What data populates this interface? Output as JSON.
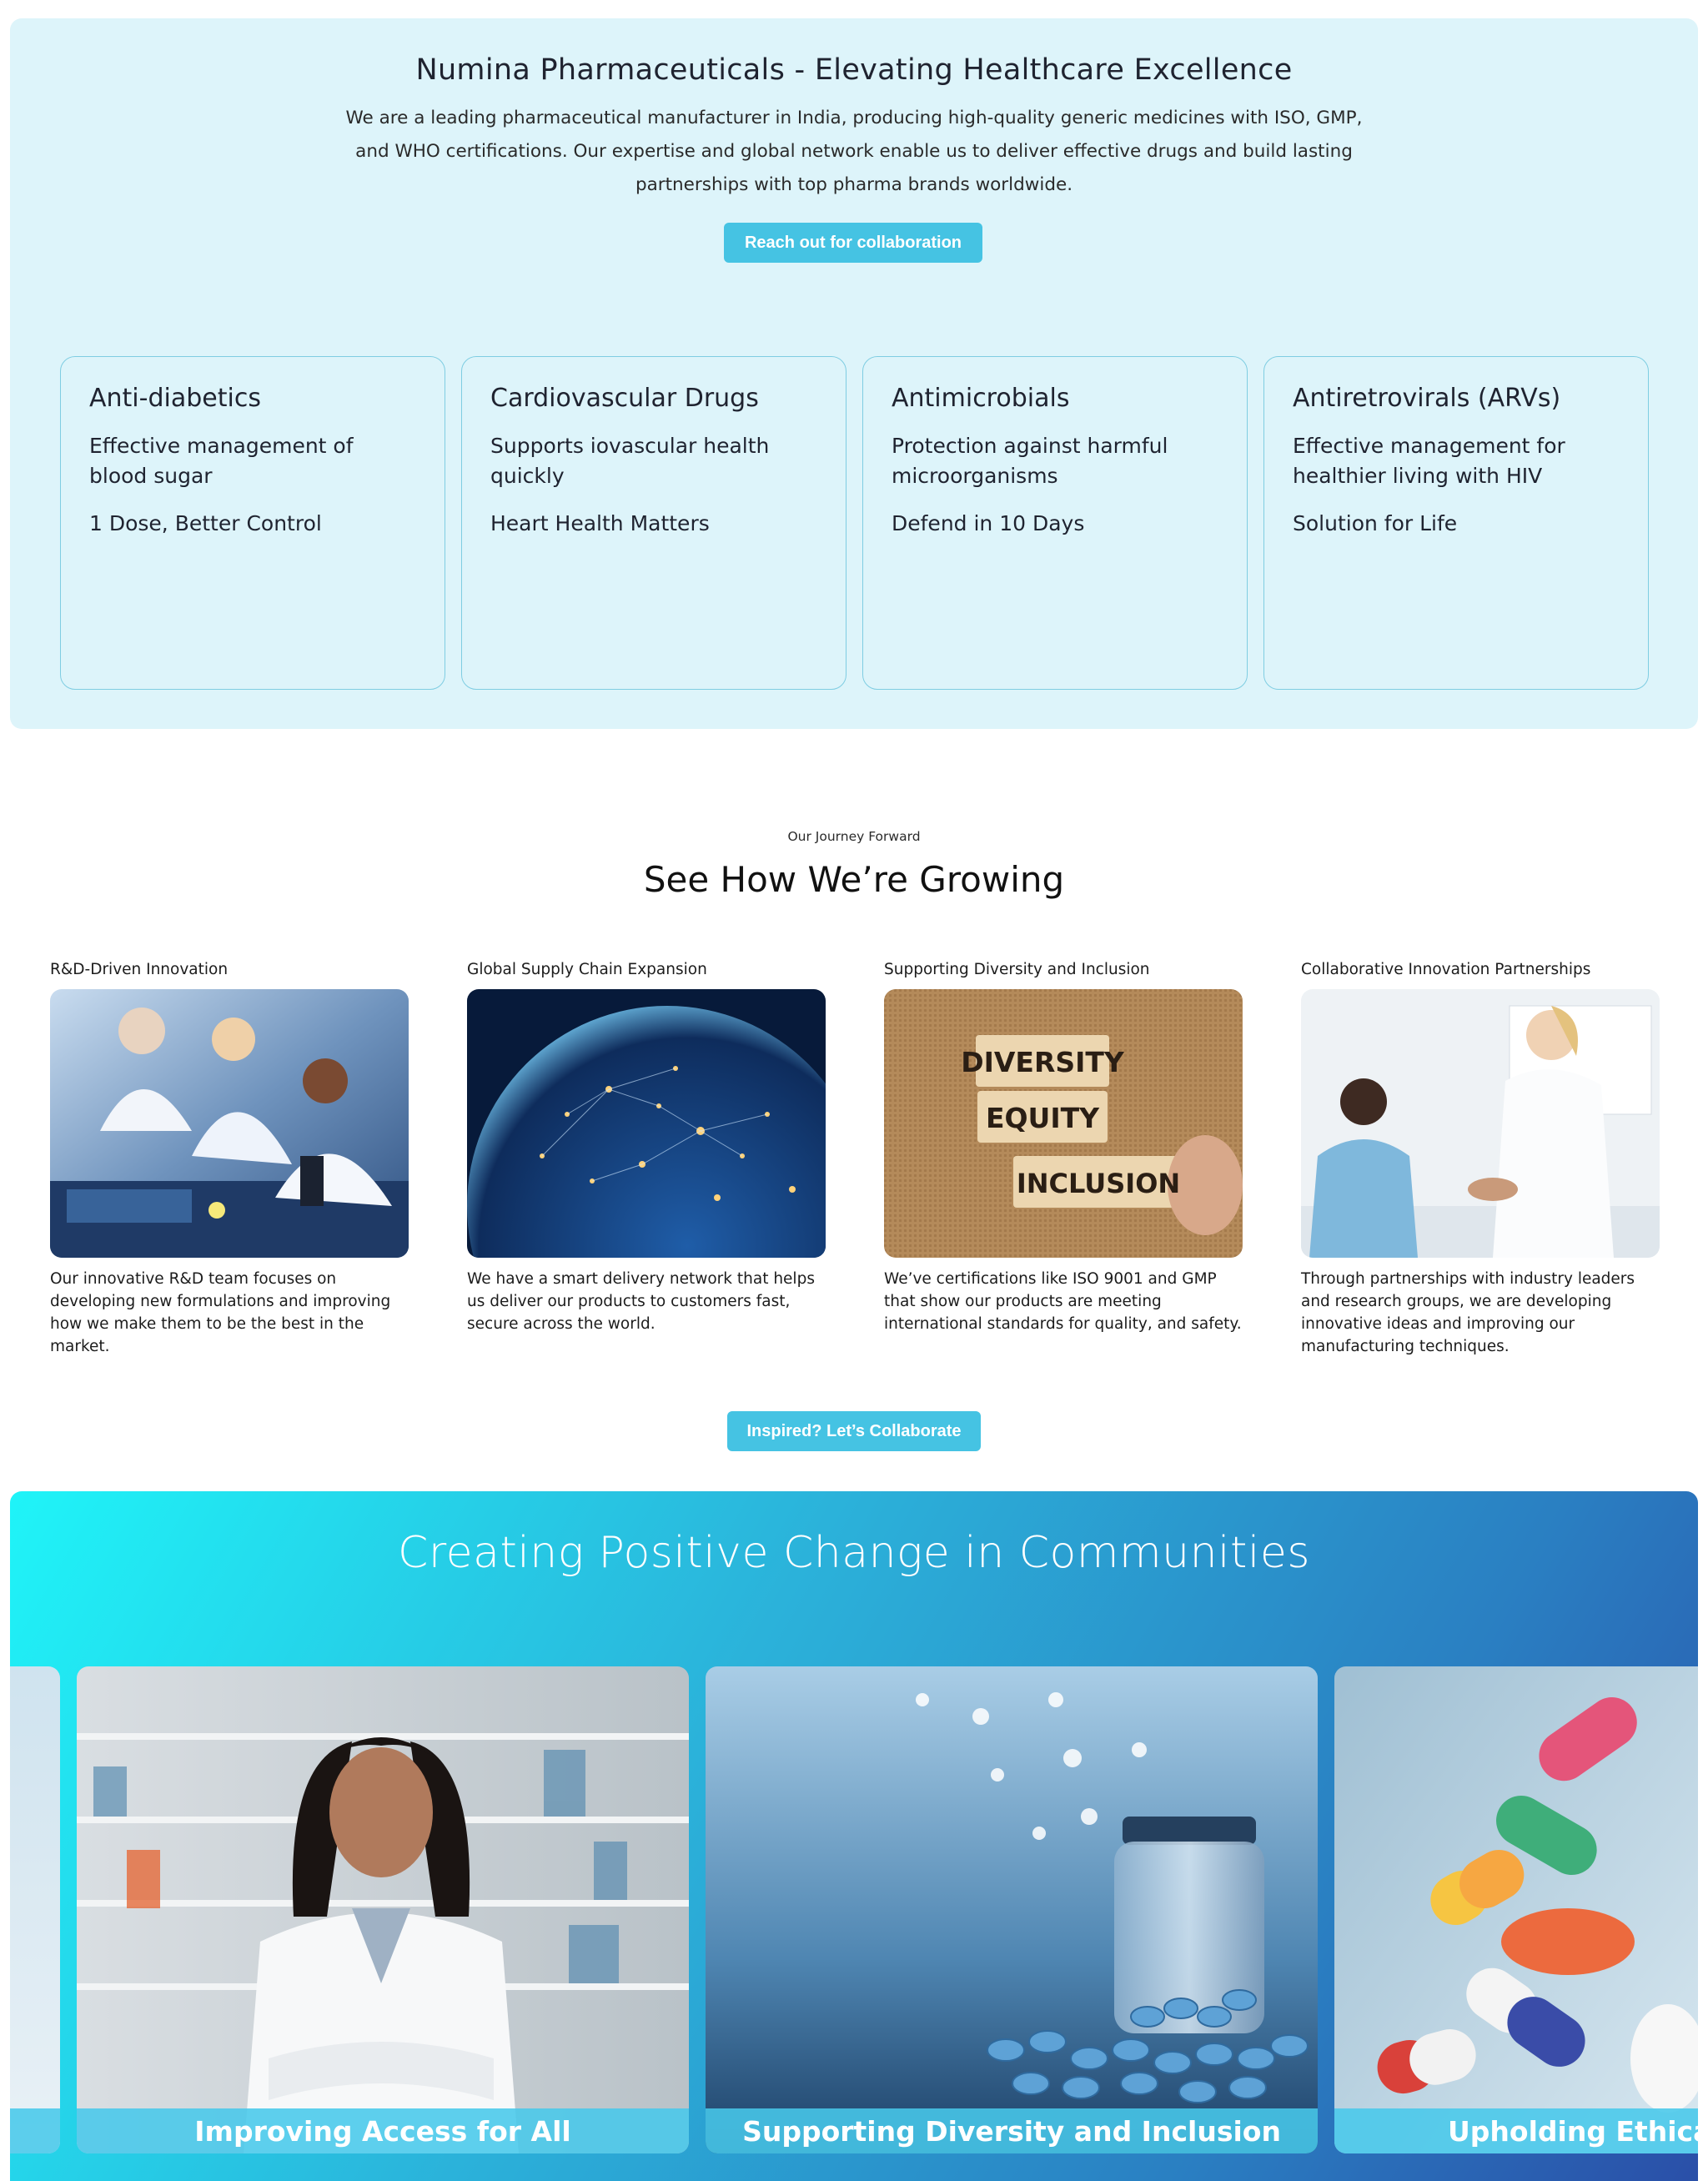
{
  "hero": {
    "title": "Numina Pharmaceuticals - Elevating Healthcare Excellence",
    "description": "We are a leading pharmaceutical manufacturer in India, producing high-quality generic medicines with ISO, GMP, and WHO certifications. Our expertise and global network enable us to deliver effective drugs and build lasting partnerships with top pharma brands worldwide.",
    "cta_label": "Reach out for collaboration",
    "cards": [
      {
        "title": "Anti-diabetics",
        "desc": "Effective management of blood sugar",
        "tag": "1 Dose, Better Control"
      },
      {
        "title": "Cardiovascular Drugs",
        "desc": "Supports iovascular health quickly",
        "tag": "Heart Health Matters"
      },
      {
        "title": "Antimicrobials",
        "desc": "Protection against harmful microorganisms",
        "tag": "Defend in 10 Days"
      },
      {
        "title": "Antiretrovirals (ARVs)",
        "desc": "Effective management for healthier living with HIV",
        "tag": "Solution for Life"
      }
    ]
  },
  "journey": {
    "eyebrow": "Our Journey Forward",
    "title": "See How We’re Growing",
    "items": [
      {
        "label": "R&D-Driven Innovation",
        "text": "Our innovative R&D team focuses on developing new formulations and improving how we make them to be the best in the market.",
        "image": "lab-scientists-image"
      },
      {
        "label": "Global Supply Chain Expansion",
        "text": "We have a smart delivery network that helps us deliver our products to customers fast, secure across the world.",
        "image": "globe-network-image"
      },
      {
        "label": "Supporting Diversity and Inclusion",
        "text": "We’ve certifications like ISO 9001 and GMP that show our products are meeting international standards for quality, and safety.",
        "image": "diversity-blocks-image",
        "blocks": [
          "DIVERSITY",
          "EQUITY",
          "INCLUSION"
        ]
      },
      {
        "label": "Collaborative Innovation Partnerships",
        "text": "Through partnerships with industry leaders and research groups, we are developing innovative ideas and improving our manufacturing techniques.",
        "image": "doctors-handshake-image"
      }
    ],
    "cta_label": "Inspired? Let’s Collaborate"
  },
  "community": {
    "title": "Creating Positive Change in Communities",
    "slides": [
      {
        "caption": "Improving Access for All",
        "image": "pharmacist-image"
      },
      {
        "caption": "Supporting Diversity and Inclusion",
        "image": "pill-jar-image"
      },
      {
        "caption": "Upholding Ethical S",
        "image": "capsules-image"
      }
    ]
  },
  "colors": {
    "hero_bg": "#ddf4fa",
    "accent": "#45c3e3",
    "card_border": "#7fcde2",
    "community_gradient_start": "#1ff4f8",
    "community_gradient_end": "#2a4fa8"
  }
}
